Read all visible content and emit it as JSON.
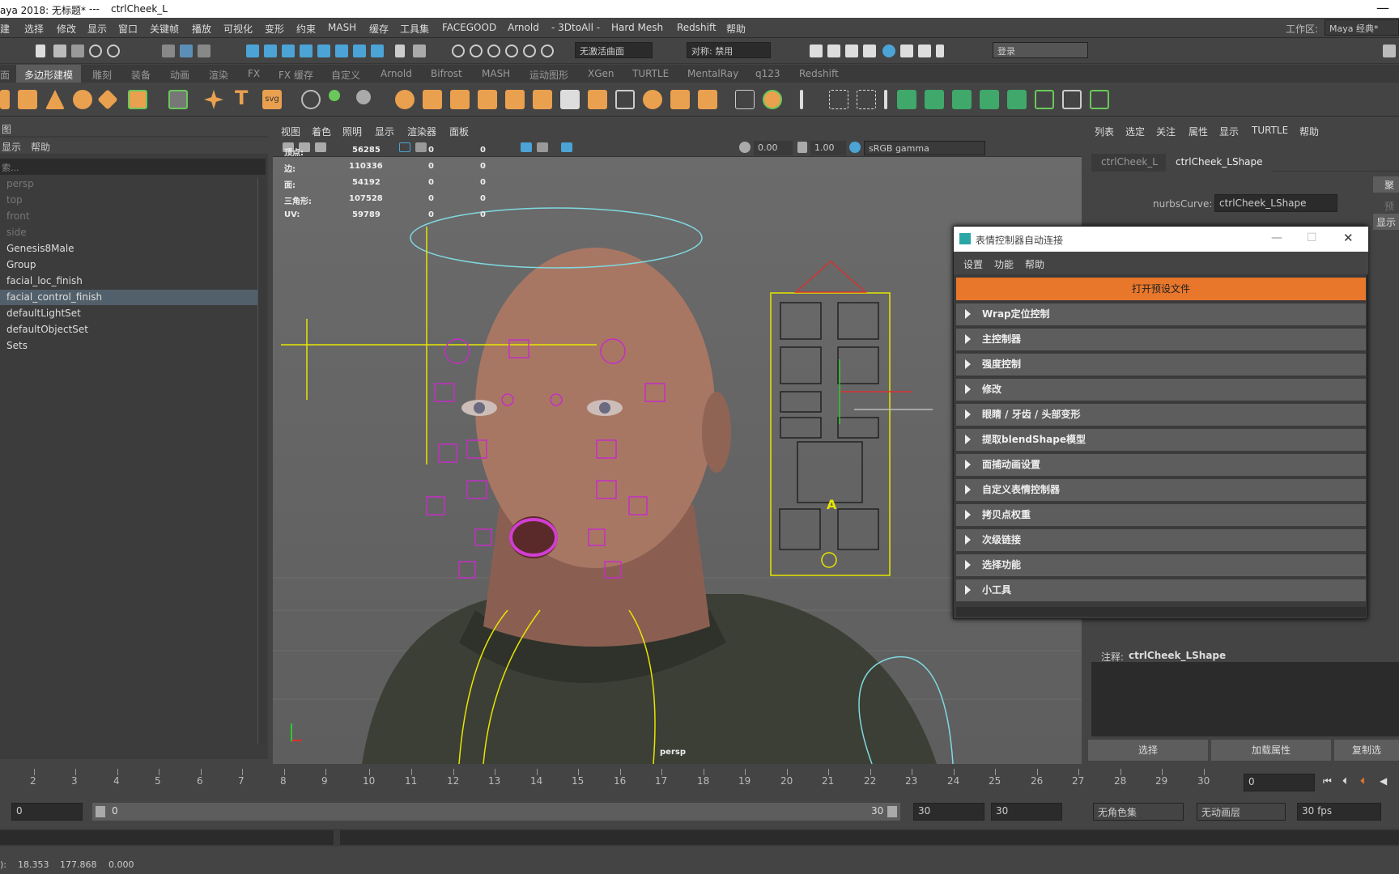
{
  "title_bar": {
    "app": "aya 2018: 无标题*",
    "separator": "---",
    "node": "ctrlCheek_L",
    "close": "—"
  },
  "menu": [
    "建",
    "选择",
    "修改",
    "显示",
    "窗口",
    "关键帧",
    "播放",
    "可视化",
    "变形",
    "约束",
    "MASH",
    "缓存",
    "工具集",
    "FACEGOOD",
    "Arnold",
    "- 3DtoAll -",
    "Hard Mesh",
    "Redshift",
    "帮助"
  ],
  "workspace": {
    "label": "工作区:",
    "value": "Maya 经典*"
  },
  "status_line": {
    "live_surface": "无激活曲面",
    "symmetry": "对称: 禁用",
    "login": "登录"
  },
  "shelf_tabs": [
    "面",
    "多边形建模",
    "雕刻",
    "装备",
    "动画",
    "渲染",
    "FX",
    "FX 缓存",
    "自定义",
    "Arnold",
    "Bifrost",
    "MASH",
    "运动图形",
    "XGen",
    "TURTLE",
    "MentalRay",
    "q123",
    "Redshift"
  ],
  "shelf_text_icon": "T",
  "shelf_svg_icon": "svg",
  "outliner": {
    "header": "图",
    "menu": [
      "显示",
      "帮助"
    ],
    "search_placeholder": "索...",
    "items": [
      {
        "label": "persp",
        "dim": true
      },
      {
        "label": "top",
        "dim": true
      },
      {
        "label": "front",
        "dim": true
      },
      {
        "label": "side",
        "dim": true
      },
      {
        "label": "Genesis8Male",
        "dim": false
      },
      {
        "label": "Group",
        "dim": false
      },
      {
        "label": "facial_loc_finish",
        "dim": false
      },
      {
        "label": "facial_control_finish",
        "dim": false,
        "selected": true
      },
      {
        "label": "defaultLightSet",
        "dim": false
      },
      {
        "label": "defaultObjectSet",
        "dim": false
      },
      {
        "label": "Sets",
        "dim": false
      }
    ]
  },
  "viewport": {
    "menu": [
      "视图",
      "着色",
      "照明",
      "显示",
      "渲染器",
      "面板"
    ],
    "exposure": "0.00",
    "gamma": "1.00",
    "colorspace": "sRGB gamma",
    "camera": "persp",
    "hud": [
      {
        "label": "顶点:",
        "v1": "56285",
        "v2": "0",
        "v3": "0"
      },
      {
        "label": "边:",
        "v1": "110336",
        "v2": "0",
        "v3": "0"
      },
      {
        "label": "面:",
        "v1": "54192",
        "v2": "0",
        "v3": "0"
      },
      {
        "label": "三角形:",
        "v1": "107528",
        "v2": "0",
        "v3": "0"
      },
      {
        "label": "UV:",
        "v1": "59789",
        "v2": "0",
        "v3": "0"
      }
    ],
    "picker_letter": "A"
  },
  "attr_editor": {
    "menu": [
      "列表",
      "选定",
      "关注",
      "属性",
      "显示",
      "TURTLE",
      "帮助"
    ],
    "tabs": [
      "ctrlCheek_L",
      "ctrlCheek_LShape"
    ],
    "curve_label": "nurbsCurve:",
    "curve_value": "ctrlCheek_LShape",
    "side_labels": [
      "聚",
      "预",
      "显示"
    ],
    "notes_label": "注释:",
    "notes_value": "ctrlCheek_LShape",
    "buttons": [
      "选择",
      "加载属性",
      "复制选"
    ]
  },
  "dialog": {
    "title": "表情控制器自动连接",
    "menu": [
      "设置",
      "功能",
      "帮助"
    ],
    "open_button": "打开预设文件",
    "sections": [
      "Wrap定位控制",
      "主控制器",
      "强度控制",
      "修改",
      "眼睛 / 牙齿 / 头部变形",
      "提取blendShape模型",
      "面捕动画设置",
      "自定义表情控制器",
      "拷贝点权重",
      "次级链接",
      "选择功能",
      "小工具"
    ],
    "accent": "#e8772b"
  },
  "timeline": {
    "ticks": [
      "2",
      "3",
      "4",
      "5",
      "6",
      "7",
      "8",
      "9",
      "10",
      "11",
      "12",
      "13",
      "14",
      "15",
      "16",
      "17",
      "18",
      "19",
      "20",
      "21",
      "22",
      "23",
      "24",
      "25",
      "26",
      "27",
      "28",
      "29",
      "30"
    ],
    "current_frame": "0"
  },
  "range": {
    "start": "0",
    "inner_start": "0",
    "inner_end": "30",
    "end1": "30",
    "end2": "30",
    "character_set": "无角色集",
    "anim_layer": "无动画层",
    "fps": "30 fps"
  },
  "help_line": {
    "prefix": "):",
    "x": "18.353",
    "y": "177.868",
    "z": "0.000"
  }
}
